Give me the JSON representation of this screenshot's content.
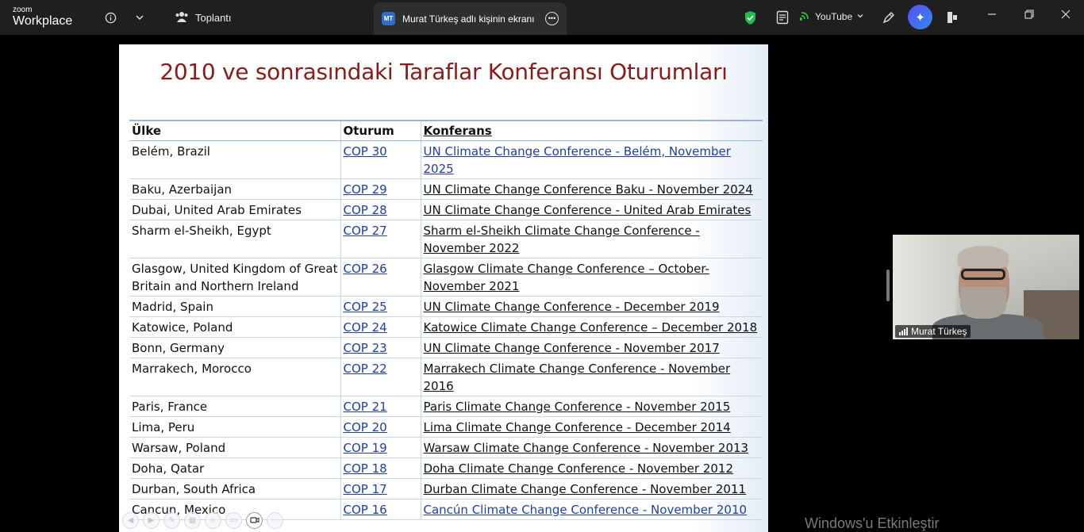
{
  "app": {
    "logo_small": "zoom",
    "logo_big": "Workplace"
  },
  "header": {
    "meeting_tab_label": "Toplantı",
    "share_tab_avatar": "MT",
    "share_tab_label": "Murat Türkeş adlı kişinin ekranı",
    "youtube_label": "YouTube",
    "accent_color": "#2d6fc4"
  },
  "slide": {
    "title": "2010 ve sonrasındaki Taraflar Konferansı Oturumları",
    "columns": [
      "Ülke",
      "Oturum",
      "Konferans"
    ],
    "rows": [
      {
        "country": "Belém, Brazil",
        "session": "COP 30",
        "conference": "UN Climate Change Conference - Belém, November 2025",
        "blue": true
      },
      {
        "country": "Baku, Azerbaijan",
        "session": "COP 29",
        "conference": "UN Climate Change Conference Baku - November 2024",
        "blue": false
      },
      {
        "country": "Dubai, United Arab Emirates",
        "session": "COP 28",
        "conference": "UN Climate Change Conference - United Arab Emirates",
        "blue": false
      },
      {
        "country": "Sharm el-Sheikh, Egypt",
        "session": "COP 27",
        "conference": "Sharm el-Sheikh Climate Change Conference - November 2022",
        "blue": false
      },
      {
        "country": "Glasgow, United Kingdom of Great Britain and Northern Ireland",
        "session": "COP 26",
        "conference": "Glasgow Climate Change Conference – October-November 2021",
        "blue": false
      },
      {
        "country": "Madrid, Spain",
        "session": "COP 25",
        "conference": "UN Climate Change Conference - December 2019",
        "blue": false
      },
      {
        "country": "Katowice, Poland",
        "session": "COP 24",
        "conference": "Katowice Climate Change Conference – December 2018",
        "blue": false
      },
      {
        "country": "Bonn, Germany",
        "session": "COP 23",
        "conference": "UN Climate Change Conference - November 2017",
        "blue": false
      },
      {
        "country": "Marrakech, Morocco",
        "session": "COP 22",
        "conference": "Marrakech Climate Change Conference - November 2016",
        "blue": false
      },
      {
        "country": "Paris, France",
        "session": "COP 21",
        "conference": "Paris Climate Change Conference - November 2015",
        "blue": false
      },
      {
        "country": "Lima, Peru",
        "session": "COP 20",
        "conference": "Lima Climate Change Conference - December 2014",
        "blue": false
      },
      {
        "country": "Warsaw, Poland",
        "session": "COP 19",
        "conference": "Warsaw Climate Change Conference - November 2013",
        "blue": false
      },
      {
        "country": "Doha, Qatar",
        "session": "COP 18",
        "conference": "Doha Climate Change Conference - November 2012",
        "blue": false
      },
      {
        "country": "Durban, South Africa",
        "session": "COP 17",
        "conference": "Durban Climate Change Conference - November 2011",
        "blue": false
      },
      {
        "country": "Cancun, Mexico",
        "session": "COP 16",
        "conference": "Cancún Climate Change Conference - November 2010",
        "blue": true
      }
    ],
    "title_color": "#8b1a1a",
    "link_color": "#1f3fa0"
  },
  "video": {
    "participant_name": "Murat Türkeş"
  },
  "watermark": "Windows'u Etkinleştir"
}
